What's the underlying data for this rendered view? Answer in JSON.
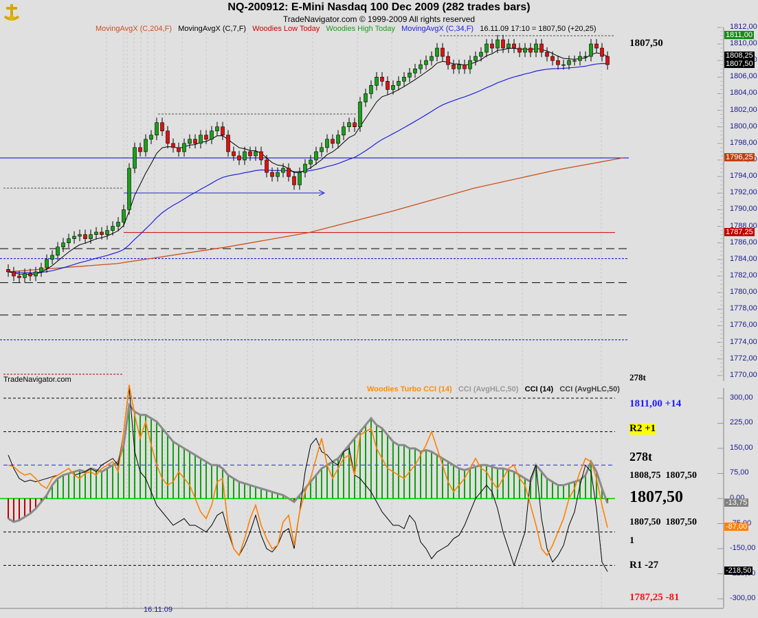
{
  "header": {
    "title": "NQ-200912:  E-Mini Nasdaq 100 Dec 2009  (282 trades bars)",
    "copyright": "TradeNavigator.com © 1999-2009 All rights reserved",
    "legend": [
      {
        "label": "MovingAvgX (C,204,F)",
        "color": "#c8501e"
      },
      {
        "label": "MovingAvgX (C,7,F)",
        "color": "#000000"
      },
      {
        "label": "Woodies Low Today",
        "color": "#d00000"
      },
      {
        "label": "Woodies High Today",
        "color": "#1a9a1a"
      },
      {
        "label": "MovingAvgX (C,34,F)",
        "color": "#2020e0"
      }
    ],
    "status": "16.11.09 17:10 = 1807,50 (+20,25)"
  },
  "watermark": "TradeNavigator.com",
  "lower_legend": [
    {
      "label": "Woodies Turbo CCI (14)",
      "color": "#ff8c00"
    },
    {
      "label": "CCI (AvgHLC,50)",
      "color": "#909090"
    },
    {
      "label": "CCI (14)",
      "color": "#000000"
    },
    {
      "label": "CCI (AvgHLC,50)",
      "color": "#404040"
    }
  ],
  "right_panel": {
    "price": "1807,50",
    "ticks_top": "278t",
    "high_line": "1811,00 +14",
    "r2": "R2 +1",
    "ticks": "278t",
    "hi_close": [
      "1808,75",
      "1807,50"
    ],
    "last": "1807,50",
    "lo_close": [
      "1807,50",
      "1807,50"
    ],
    "count": "1",
    "r1": "R1 -27",
    "low_line": "1787,25 -81"
  },
  "price_axis": {
    "ticks": [
      "1812,00",
      "1810,00",
      "1808,00",
      "1806,00",
      "1804,00",
      "1802,00",
      "1800,00",
      "1798,00",
      "1796,00",
      "1794,00",
      "1792,00",
      "1790,00",
      "1788,00",
      "1786,00",
      "1784,00",
      "1782,00",
      "1780,00",
      "1778,00",
      "1776,00",
      "1774,00",
      "1772,00",
      "1770,00"
    ],
    "tags": [
      {
        "label": "1811,00",
        "value": 1811.0,
        "color": "#1a8a1a"
      },
      {
        "label": "1808,25",
        "value": 1808.5,
        "color": "#000000"
      },
      {
        "label": "1807,50",
        "value": 1807.5,
        "color": "#000000"
      },
      {
        "label": "1796,25",
        "value": 1796.25,
        "color": "#c04010"
      },
      {
        "label": "1787,25",
        "value": 1787.25,
        "color": "#c00000"
      }
    ]
  },
  "cci_axis": {
    "ticks": [
      "300,00",
      "225,00",
      "150,00",
      "75,00",
      "0,00",
      "-75,00",
      "-150,00",
      "-225,00",
      "-300,00"
    ],
    "tags": [
      {
        "label": "-13,75",
        "value": -13.75,
        "color": "#808080"
      },
      {
        "label": "-87,00",
        "value": -87,
        "color": "#ff8000"
      },
      {
        "label": "-218,50",
        "value": -218.5,
        "color": "#000000"
      }
    ]
  },
  "x_axis": {
    "date_label": "16.11.09"
  },
  "chart_data": [
    {
      "type": "candlestick",
      "title": "NQ-200912 price",
      "ylim": [
        1769,
        1812.5
      ],
      "closes": [
        1782.5,
        1782,
        1781.8,
        1782.3,
        1782,
        1782.5,
        1783,
        1784,
        1784.5,
        1785.5,
        1786,
        1786.5,
        1786.8,
        1787,
        1786.5,
        1787,
        1787.3,
        1787,
        1787.5,
        1788,
        1788.5,
        1790,
        1795,
        1797.5,
        1797,
        1798.5,
        1799,
        1800.5,
        1799.5,
        1798,
        1797.5,
        1797,
        1798,
        1798.5,
        1798,
        1799,
        1798.5,
        1799.5,
        1800,
        1799,
        1797,
        1796.5,
        1796,
        1797,
        1796.5,
        1797,
        1796,
        1794.5,
        1794,
        1794.5,
        1795,
        1794,
        1793,
        1794.5,
        1795.5,
        1796,
        1797,
        1797.5,
        1798.5,
        1798,
        1799,
        1800,
        1800.5,
        1800,
        1803,
        1804,
        1805,
        1806,
        1805.5,
        1804.5,
        1805,
        1805.5,
        1806,
        1806.5,
        1807,
        1807.5,
        1808,
        1808.5,
        1809.5,
        1808.5,
        1807.5,
        1807,
        1807.5,
        1807,
        1808,
        1808.5,
        1809,
        1810,
        1809.5,
        1810.5,
        1809.5,
        1810,
        1809.5,
        1809,
        1809.5,
        1809,
        1810,
        1809,
        1808.5,
        1808,
        1807.5,
        1807.5,
        1808,
        1808,
        1808.5,
        1808.5,
        1810,
        1809.5,
        1808.5,
        1807.5
      ],
      "ma204_keypoints": [
        [
          0,
          1782.5
        ],
        [
          20,
          1783.5
        ],
        [
          40,
          1785.5
        ],
        [
          55,
          1787.25
        ],
        [
          70,
          1789.8
        ],
        [
          85,
          1792.6
        ],
        [
          100,
          1794.8
        ],
        [
          112,
          1796.25
        ]
      ],
      "levels": [
        {
          "name": "woodies-high",
          "value": 1796.25,
          "color": "#0000e0",
          "style": "solid"
        },
        {
          "name": "woodies-low",
          "value": 1787.25,
          "color": "#d00000",
          "style": "solid"
        },
        {
          "name": "pivot-1",
          "value": 1785.3,
          "color": "#000000",
          "style": "dash"
        },
        {
          "name": "pivot-2",
          "value": 1784.1,
          "color": "#0000e0",
          "style": "dot"
        },
        {
          "name": "pivot-3",
          "value": 1781.2,
          "color": "#000000",
          "style": "dash"
        },
        {
          "name": "pivot-4",
          "value": 1777.3,
          "color": "#000000",
          "style": "dash"
        },
        {
          "name": "pivot-5",
          "value": 1774.3,
          "color": "#0000e0",
          "style": "dot"
        }
      ]
    },
    {
      "type": "line",
      "title": "CCI panel",
      "ylim": [
        -310,
        320
      ],
      "cci50_avghlc": [
        -60,
        -70,
        -65,
        -55,
        -45,
        -30,
        -10,
        10,
        40,
        60,
        70,
        75,
        80,
        85,
        80,
        90,
        85,
        80,
        90,
        100,
        110,
        160,
        280,
        260,
        250,
        250,
        240,
        230,
        210,
        190,
        170,
        160,
        150,
        140,
        130,
        120,
        110,
        100,
        100,
        90,
        70,
        60,
        50,
        45,
        40,
        35,
        30,
        25,
        20,
        15,
        10,
        0,
        -10,
        10,
        30,
        50,
        70,
        90,
        100,
        110,
        120,
        140,
        160,
        180,
        200,
        220,
        240,
        220,
        210,
        190,
        170,
        160,
        160,
        150,
        150,
        140,
        145,
        140,
        130,
        120,
        110,
        100,
        90,
        85,
        90,
        95,
        100,
        100,
        95,
        90,
        90,
        85,
        80,
        70,
        60,
        50,
        100,
        80,
        60,
        50,
        40,
        40,
        45,
        50,
        55,
        70,
        110,
        80,
        30,
        -14
      ],
      "turbo_cci14": [
        100,
        95,
        80,
        70,
        75,
        60,
        40,
        30,
        60,
        70,
        80,
        90,
        70,
        60,
        75,
        80,
        70,
        90,
        100,
        110,
        80,
        200,
        340,
        250,
        180,
        230,
        160,
        100,
        60,
        40,
        50,
        80,
        60,
        40,
        0,
        -40,
        -60,
        -20,
        50,
        60,
        -80,
        -150,
        -170,
        -120,
        -60,
        -20,
        -80,
        -120,
        -150,
        -140,
        -70,
        -50,
        -140,
        -40,
        20,
        60,
        120,
        180,
        100,
        60,
        90,
        120,
        130,
        70,
        190,
        200,
        210,
        150,
        120,
        90,
        80,
        70,
        60,
        80,
        100,
        130,
        160,
        200,
        150,
        100,
        50,
        20,
        40,
        60,
        90,
        120,
        90,
        80,
        50,
        30,
        60,
        90,
        100,
        60,
        40,
        -20,
        -80,
        -150,
        -170,
        -140,
        -100,
        -60,
        0,
        30,
        80,
        120,
        110,
        60,
        -20,
        -87
      ],
      "cci14": [
        130,
        90,
        60,
        50,
        55,
        50,
        55,
        60,
        65,
        70,
        80,
        90,
        70,
        75,
        80,
        90,
        80,
        100,
        110,
        120,
        100,
        200,
        330,
        140,
        80,
        60,
        20,
        -20,
        -40,
        -60,
        -80,
        -70,
        -60,
        -80,
        -80,
        -90,
        -100,
        -80,
        -50,
        -40,
        -100,
        -150,
        -170,
        -140,
        -100,
        -50,
        -110,
        -150,
        -160,
        -140,
        -100,
        -90,
        -150,
        -40,
        80,
        160,
        180,
        140,
        130,
        110,
        100,
        140,
        150,
        70,
        60,
        40,
        20,
        -10,
        -40,
        -60,
        -80,
        -80,
        -90,
        -50,
        -70,
        -130,
        -150,
        -180,
        -160,
        -150,
        -140,
        -120,
        -110,
        -80,
        -40,
        0,
        20,
        40,
        20,
        -30,
        -100,
        -150,
        -200,
        -150,
        -100,
        60,
        100,
        -60,
        -150,
        -190,
        -170,
        -140,
        -80,
        -40,
        40,
        100,
        80,
        -30,
        -190,
        -218.5
      ],
      "levels": [
        300,
        200,
        100,
        0,
        -100,
        -200
      ]
    }
  ]
}
